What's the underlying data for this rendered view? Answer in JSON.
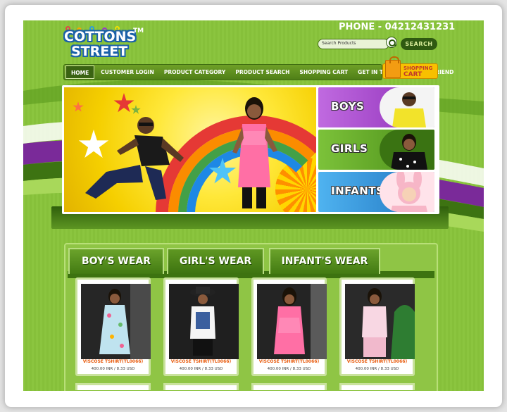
{
  "header": {
    "logo_line1": "COTTONS",
    "logo_line2": "STREET",
    "logo_tm": "TM",
    "phone_label": "PHONE -",
    "phone_number": "04212431231",
    "search_placeholder": "Search Products",
    "search_button": "SEARCH"
  },
  "nav": {
    "items": [
      {
        "label": "HOME",
        "active": true
      },
      {
        "label": "CUSTOMER LOGIN"
      },
      {
        "label": "PRODUCT CATEGORY"
      },
      {
        "label": "PRODUCT SEARCH"
      },
      {
        "label": "SHOPPING CART"
      },
      {
        "label": "GET IN TOUCH"
      },
      {
        "label": "TELL A FRIEND"
      }
    ],
    "cart_line1": "SHOPPING",
    "cart_line2": "CART"
  },
  "banner": {
    "categories": [
      {
        "label": "BOYS",
        "color": "#a64ad0"
      },
      {
        "label": "GIRLS",
        "color": "#5c9e20"
      },
      {
        "label": "INFANTS",
        "color": "#2a8fd6"
      }
    ]
  },
  "tabs": [
    "BOY'S WEAR",
    "GIRL'S WEAR",
    "INFANT'S WEAR"
  ],
  "products": [
    {
      "title": "VISCOSE TSHIRT(TL0066)",
      "price": "400.00 INR / 8.33 USD"
    },
    {
      "title": "VISCOSE TSHIRT(TL0066)",
      "price": "400.00 INR / 8.33 USD"
    },
    {
      "title": "VISCOSE TSHIRT(TL0066)",
      "price": "400.00 INR / 8.33 USD"
    },
    {
      "title": "VISCOSE TSHIRT(TL0066)",
      "price": "400.00 INR / 8.33 USD"
    }
  ],
  "colors": {
    "background": "#8bc53f",
    "nav": "#4f7f17",
    "accent": "#f8c000",
    "price_title": "#e85a0c"
  }
}
